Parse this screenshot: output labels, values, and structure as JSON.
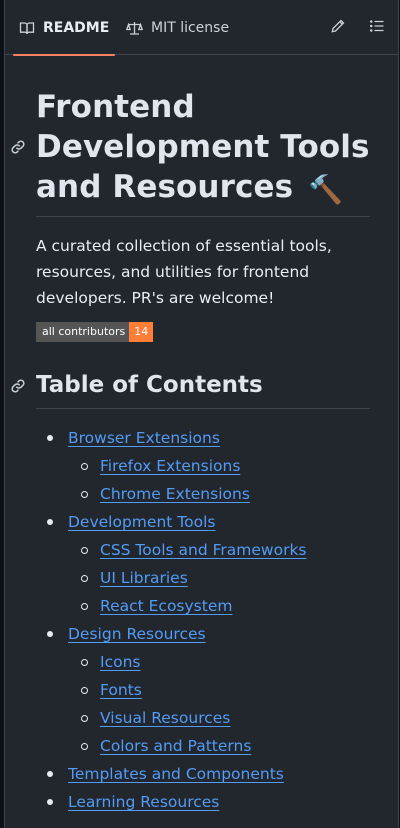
{
  "tabs": {
    "readme_label": "README",
    "license_label": "MIT license"
  },
  "readme": {
    "title": "Frontend Development Tools and Resources",
    "title_emoji": "🔨",
    "description": "A curated collection of essential tools, resources, and utilities for frontend developers. PR's are welcome!",
    "badge": {
      "label": "all contributors",
      "count": "14",
      "label_color": "#555555",
      "count_color": "#fe7d37"
    },
    "toc_heading": "Table of Contents",
    "toc": [
      {
        "label": "Browser Extensions",
        "level": 1
      },
      {
        "label": "Firefox Extensions",
        "level": 2
      },
      {
        "label": "Chrome Extensions",
        "level": 2
      },
      {
        "label": "Development Tools",
        "level": 1
      },
      {
        "label": "CSS Tools and Frameworks",
        "level": 2
      },
      {
        "label": "UI Libraries",
        "level": 2
      },
      {
        "label": "React Ecosystem",
        "level": 2
      },
      {
        "label": "Design Resources",
        "level": 1
      },
      {
        "label": "Icons",
        "level": 2
      },
      {
        "label": "Fonts",
        "level": 2
      },
      {
        "label": "Visual Resources",
        "level": 2
      },
      {
        "label": "Colors and Patterns",
        "level": 2
      },
      {
        "label": "Templates and Components",
        "level": 1
      },
      {
        "label": "Learning Resources",
        "level": 1
      }
    ]
  },
  "colors": {
    "background": "#22272e",
    "link": "#539bf5",
    "tab_underline": "#f78166"
  },
  "icons": {
    "readme_tab": "book-icon",
    "license_tab": "scale-icon",
    "edit": "pencil-icon",
    "outline": "list-icon",
    "anchor": "link-icon"
  }
}
